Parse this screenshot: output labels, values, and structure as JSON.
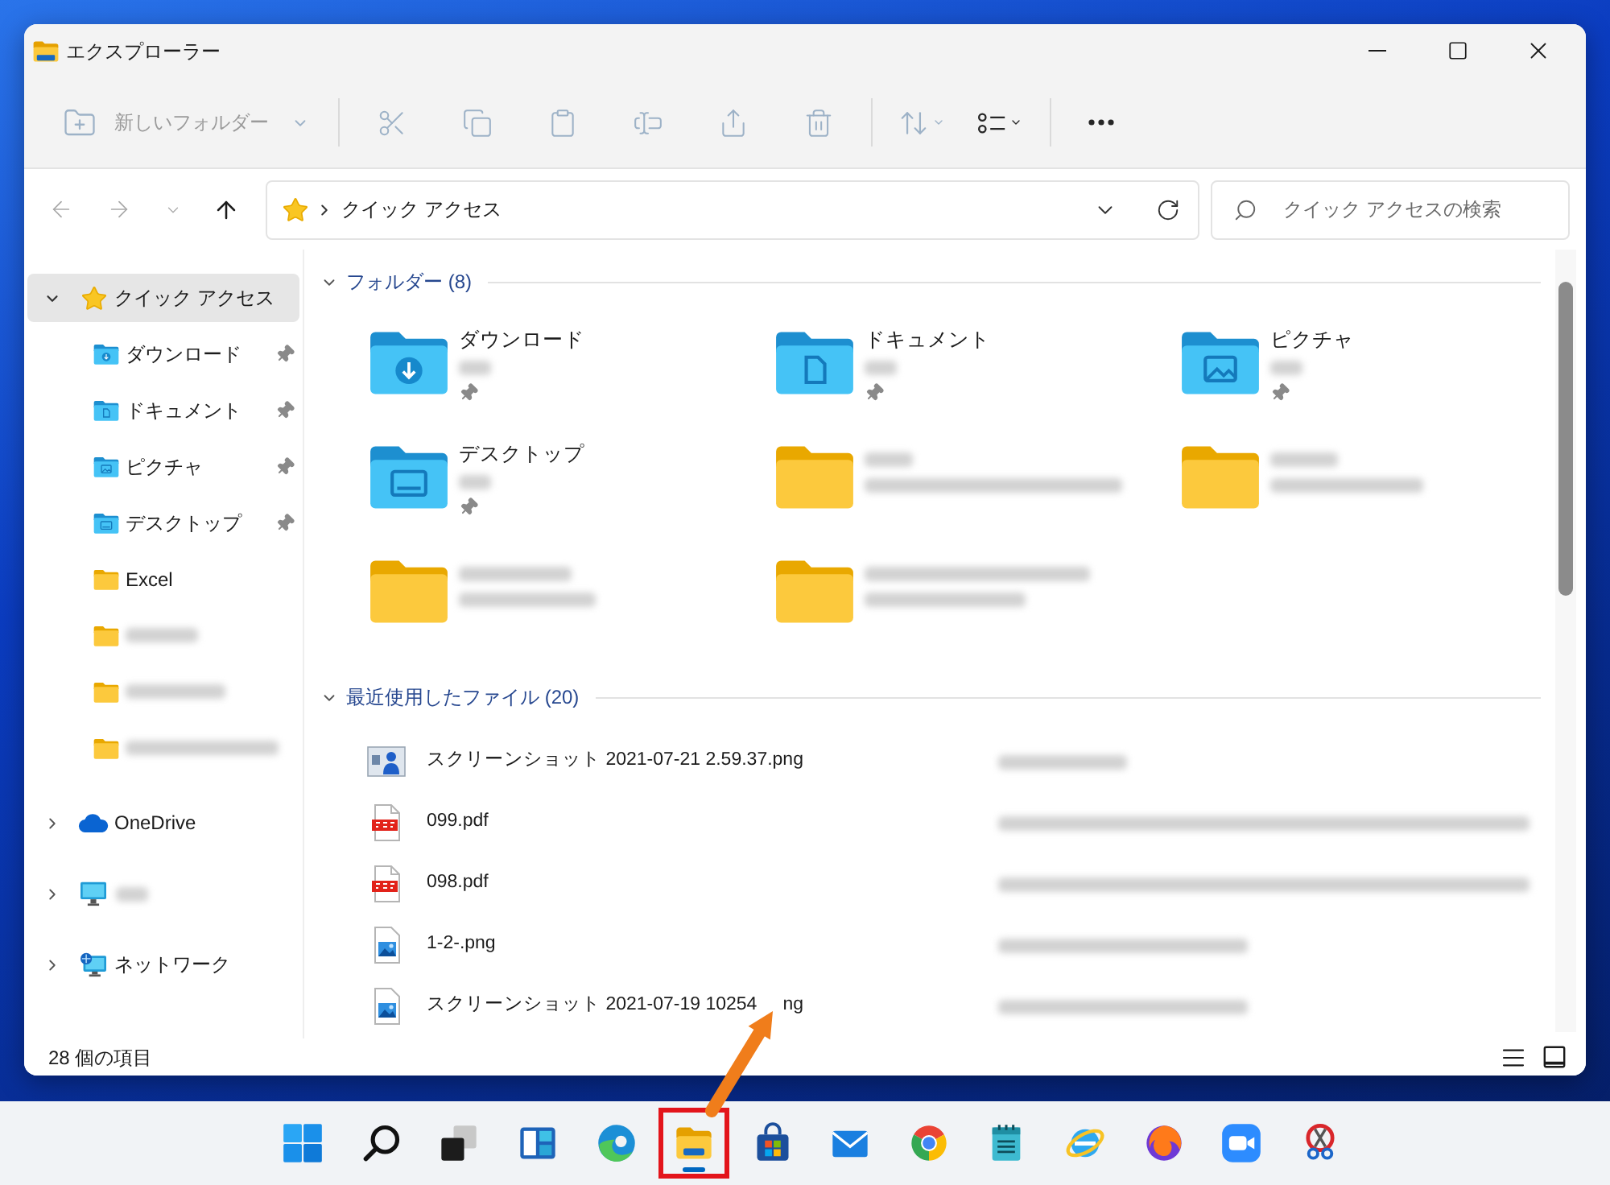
{
  "window": {
    "title": "エクスプローラー"
  },
  "toolbar": [
    {
      "kind": "new-folder",
      "label": "新しいフォルダー",
      "disabled": true
    },
    {
      "kind": "separator"
    },
    {
      "kind": "cut",
      "disabled": true
    },
    {
      "kind": "copy",
      "disabled": true
    },
    {
      "kind": "paste",
      "disabled": true
    },
    {
      "kind": "rename",
      "disabled": true
    },
    {
      "kind": "share",
      "disabled": true
    },
    {
      "kind": "delete",
      "disabled": true
    },
    {
      "kind": "separator"
    },
    {
      "kind": "sort",
      "disabled": true
    },
    {
      "kind": "view",
      "disabled": false
    },
    {
      "kind": "separator"
    },
    {
      "kind": "more",
      "disabled": false
    }
  ],
  "navigation": [
    {
      "kind": "back",
      "disabled": true
    },
    {
      "kind": "forward",
      "disabled": true
    },
    {
      "kind": "recent",
      "disabled": true
    },
    {
      "kind": "up",
      "disabled": false
    }
  ],
  "address_bar": {
    "location": "クイック アクセス"
  },
  "search": {
    "placeholder": "クイック アクセスの検索"
  },
  "sidebar": {
    "items": [
      {
        "label": "クイック アクセス",
        "kind": "quick-access",
        "expanded": true,
        "selected": true,
        "blurred": false,
        "children": [
          {
            "label": "ダウンロード",
            "kind": "downloads",
            "pinned": true,
            "selected": false,
            "blurred": false
          },
          {
            "label": "ドキュメント",
            "kind": "documents",
            "pinned": true,
            "selected": false,
            "blurred": false
          },
          {
            "label": "ピクチャ",
            "kind": "pictures",
            "pinned": true,
            "selected": false,
            "blurred": false
          },
          {
            "label": "デスクトップ",
            "kind": "desktop",
            "pinned": true,
            "selected": false,
            "blurred": false
          },
          {
            "label": "Excel",
            "kind": "folder",
            "pinned": false,
            "selected": false,
            "blurred": false
          },
          {
            "kind": "folder",
            "pinned": false,
            "selected": false,
            "blurred": true
          },
          {
            "kind": "folder",
            "pinned": false,
            "selected": false,
            "blurred": true
          },
          {
            "kind": "folder",
            "pinned": false,
            "selected": false,
            "blurred": true
          }
        ]
      },
      {
        "label": "OneDrive",
        "kind": "cloud",
        "expanded": false,
        "selected": false,
        "blurred": false
      },
      {
        "kind": "pc",
        "expanded": false,
        "selected": false,
        "blurred": true
      },
      {
        "label": "ネットワーク",
        "kind": "network",
        "expanded": false,
        "selected": false,
        "blurred": false
      }
    ]
  },
  "sections": [
    {
      "title": "フォルダー (8)",
      "kind": "tiles",
      "expanded": true,
      "items": [
        {
          "name": "ダウンロード",
          "kind": "downloads",
          "pinned": true,
          "blurred": false
        },
        {
          "name": "ドキュメント",
          "kind": "documents",
          "pinned": true,
          "blurred": false
        },
        {
          "name": "ピクチャ",
          "kind": "pictures",
          "pinned": true,
          "blurred": false
        },
        {
          "name": "デスクトップ",
          "kind": "desktop",
          "pinned": true,
          "blurred": false
        },
        {
          "kind": "folder",
          "pinned": false,
          "blurred": true
        },
        {
          "kind": "folder",
          "pinned": false,
          "blurred": true
        },
        {
          "kind": "folder",
          "pinned": false,
          "blurred": true
        },
        {
          "kind": "folder",
          "pinned": false,
          "blurred": true
        }
      ]
    },
    {
      "title": "最近使用したファイル (20)",
      "kind": "list",
      "expanded": true,
      "items": [
        {
          "name": "スクリーンショット 2021-07-21 2.59.37.png",
          "kind": "screenshot"
        },
        {
          "name": "099.pdf",
          "kind": "pdf"
        },
        {
          "name": "098.pdf",
          "kind": "pdf"
        },
        {
          "name": "1-2-.png",
          "kind": "image"
        },
        {
          "name": "スクリーンショット 2021-07-19 10254",
          "name_end": "ng",
          "kind": "image"
        }
      ]
    }
  ],
  "status_bar": {
    "item_count": "28 個の項目",
    "views": [
      {
        "kind": "details"
      },
      {
        "kind": "tiles"
      }
    ]
  },
  "taskbar": {
    "apps": [
      {
        "kind": "start",
        "running": false,
        "highlighted": false
      },
      {
        "kind": "search",
        "running": false,
        "highlighted": false
      },
      {
        "kind": "task-view",
        "running": false,
        "highlighted": false
      },
      {
        "kind": "widgets",
        "running": false,
        "highlighted": false
      },
      {
        "kind": "swirl-browser",
        "running": false,
        "highlighted": false
      },
      {
        "kind": "file-explorer",
        "running": true,
        "highlighted": true
      },
      {
        "kind": "store",
        "running": false,
        "highlighted": false
      },
      {
        "kind": "mail",
        "running": false,
        "highlighted": false
      },
      {
        "kind": "tricolor-browser",
        "running": false,
        "highlighted": false
      },
      {
        "kind": "notepad",
        "running": false,
        "highlighted": false
      },
      {
        "kind": "ring-browser",
        "running": false,
        "highlighted": false
      },
      {
        "kind": "flame-browser",
        "running": false,
        "highlighted": false
      },
      {
        "kind": "video-call",
        "running": false,
        "highlighted": false
      },
      {
        "kind": "snipping",
        "running": false,
        "highlighted": false
      }
    ]
  }
}
